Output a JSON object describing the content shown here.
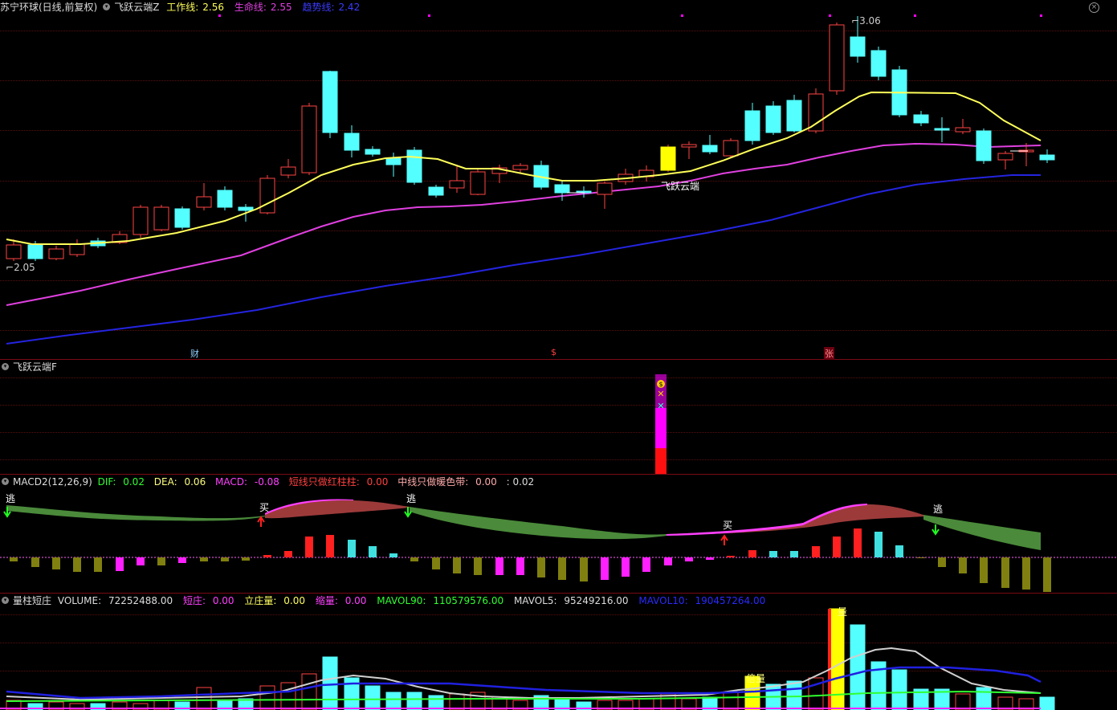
{
  "main_header": {
    "title": "苏宁环球(日线,前复权)",
    "indicator": "飞跃云端Z",
    "work_label": "工作线:",
    "work_value": "2.56",
    "life_label": "生命线:",
    "life_value": "2.55",
    "trend_label": "趋势线:",
    "trend_value": "2.42"
  },
  "main_annotations": {
    "high_price": "3.06",
    "low_price": "2.05",
    "signal_text": "飞跃云端",
    "event_cai": "财",
    "event_dollar": "$",
    "event_zhang": "张"
  },
  "panel2_header": {
    "title": "飞跃云端F"
  },
  "macd_header": {
    "title": "MACD2(12,26,9)",
    "dif_label": "DIF:",
    "dif_value": "0.02",
    "dea_label": "DEA:",
    "dea_value": "0.06",
    "macd_label": "MACD:",
    "macd_value": "-0.08",
    "short_label": "短线只做红柱柱:",
    "short_value": "0.00",
    "mid_label": "中线只做暖色带:",
    "mid_value": "0.00",
    "extra_value": ": 0.02"
  },
  "macd_signals": {
    "escape": "逃",
    "buy": "买"
  },
  "vol_header": {
    "title": "量柱短庄",
    "volume_label": "VOLUME:",
    "volume_value": "72252488.00",
    "short_label": "短庄:",
    "short_value": "0.00",
    "stand_label": "立庄量:",
    "stand_value": "0.00",
    "shrink_label": "缩量:",
    "shrink_value": "0.00",
    "mavol90_label": "MAVOL90:",
    "mavol90_value": "110579576.00",
    "mavol5_label": "MAVOL5:",
    "mavol5_value": "95249216.00",
    "mavol10_label": "MAVOL10:",
    "mavol10_value": "190457264.00"
  },
  "vol_labels": {
    "double_volume": "倍量",
    "big_volume": "量"
  },
  "colors": {
    "up": "#ff4444",
    "down": "#54ffff",
    "work_line": "#ffff5a",
    "life_line": "#e040e0",
    "trend_line": "#2424e0",
    "frame": "#7a0a14"
  },
  "icons": [
    "chevron-down-icon",
    "close-icon",
    "flag-icon",
    "arrow-up-icon",
    "arrow-down-icon"
  ]
}
